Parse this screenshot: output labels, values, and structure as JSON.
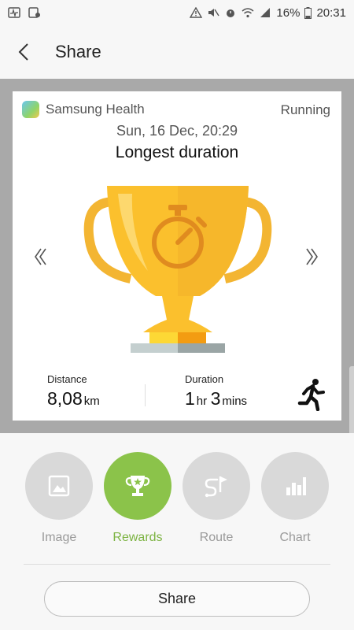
{
  "status_bar": {
    "battery": "16%",
    "time": "20:31"
  },
  "app_bar": {
    "title": "Share"
  },
  "card": {
    "app_name": "Samsung Health",
    "activity": "Running",
    "date": "Sun, 16 Dec, 20:29",
    "title": "Longest duration",
    "distance": {
      "label": "Distance",
      "value": "8,08",
      "unit": "km"
    },
    "duration": {
      "label": "Duration",
      "hours": "1",
      "hours_unit": "hr",
      "minutes": "3",
      "minutes_unit": "mins"
    }
  },
  "options": [
    {
      "label": "Image",
      "icon": "image-icon",
      "selected": false
    },
    {
      "label": "Rewards",
      "icon": "trophy-star-icon",
      "selected": true
    },
    {
      "label": "Route",
      "icon": "route-flag-icon",
      "selected": false
    },
    {
      "label": "Chart",
      "icon": "bar-chart-icon",
      "selected": false
    }
  ],
  "share_button": {
    "label": "Share"
  },
  "colors": {
    "accent_green": "#8bc34a",
    "accent_text_green": "#7cb342",
    "trophy_gold": "#f6b72b",
    "preview_background": "#a9a9a9"
  }
}
